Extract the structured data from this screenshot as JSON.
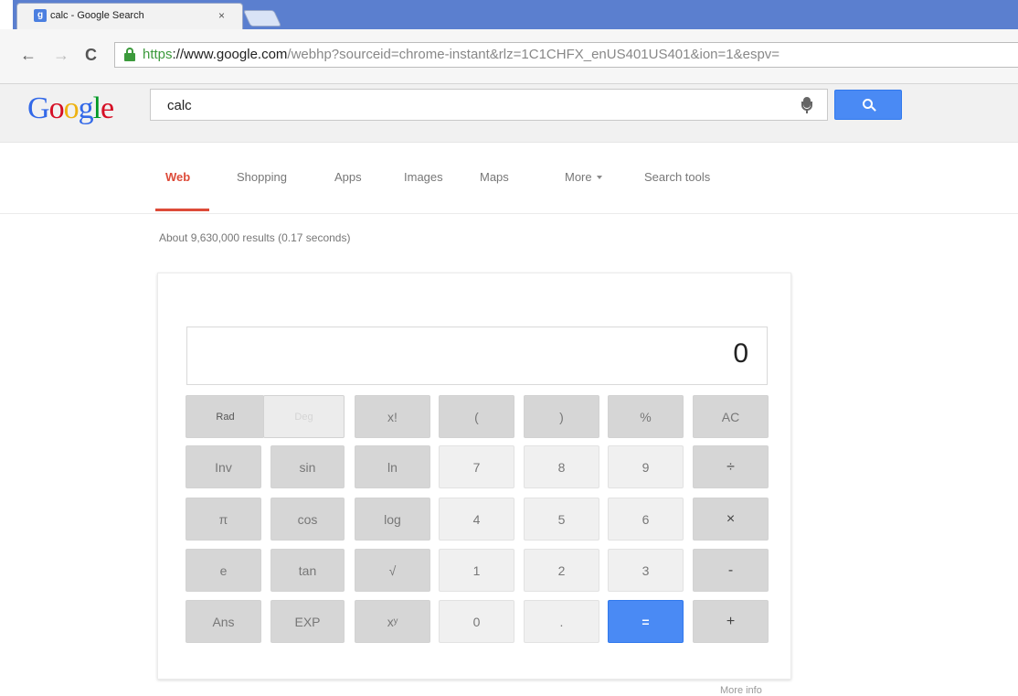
{
  "browser": {
    "tab_title": "calc - Google Search",
    "tab_close": "×",
    "favicon": "g",
    "nav": {
      "back": "←",
      "forward": "→",
      "reload": "C"
    },
    "url_proto": "https",
    "url_host": "://www.google.com",
    "url_path": "/webhp?sourceid=chrome-instant&rlz=1C1CHFX_enUS401US401&ion=1&espv="
  },
  "google": {
    "logo_letters": [
      "G",
      "o",
      "o",
      "g",
      "l",
      "e"
    ],
    "logo_colors": [
      "#3369e8",
      "#d50f25",
      "#eeb211",
      "#3369e8",
      "#009925",
      "#d50f25"
    ],
    "query": "calc"
  },
  "navtabs": {
    "web": "Web",
    "shopping": "Shopping",
    "apps": "Apps",
    "images": "Images",
    "maps": "Maps",
    "more": "More",
    "search_tools": "Search tools"
  },
  "result_stats": "About 9,630,000 results (0.17 seconds)",
  "calculator": {
    "display": "0",
    "mode_rad": "Rad",
    "mode_deg": "Deg",
    "rows": [
      [
        "x!",
        "(",
        ")",
        "%",
        "AC"
      ],
      [
        "Inv",
        "sin",
        "ln",
        "7",
        "8",
        "9",
        "÷"
      ],
      [
        "π",
        "cos",
        "log",
        "4",
        "5",
        "6",
        "×"
      ],
      [
        "e",
        "tan",
        "√",
        "1",
        "2",
        "3",
        "-"
      ],
      [
        "Ans",
        "EXP",
        "xʸ",
        "0",
        ".",
        "=",
        "+"
      ]
    ]
  },
  "more_info": "More info",
  "colors": {
    "accent_blue": "#4a8af4",
    "active_tab_red": "#dd4b39"
  }
}
